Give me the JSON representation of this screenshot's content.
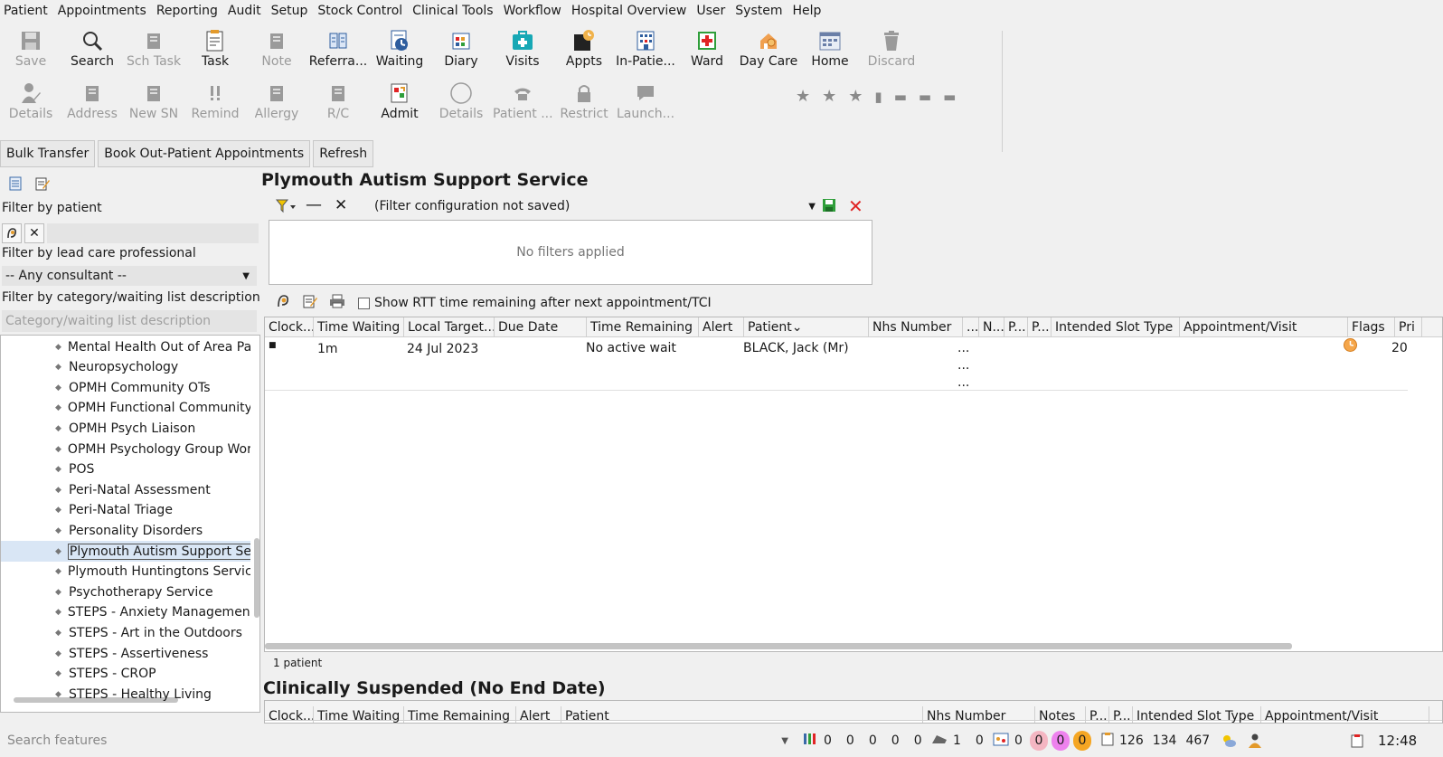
{
  "menu": [
    "Patient",
    "Appointments",
    "Reporting",
    "Audit",
    "Setup",
    "Stock Control",
    "Clinical Tools",
    "Workflow",
    "Hospital Overview",
    "User",
    "System",
    "Help"
  ],
  "toolbar_row1": [
    {
      "label": "Save",
      "icon": "save-icon",
      "enabled": false
    },
    {
      "label": "Search",
      "icon": "search-icon",
      "enabled": true
    },
    {
      "label": "Sch Task",
      "icon": "scheduled-task-icon",
      "enabled": false
    },
    {
      "label": "Task",
      "icon": "task-icon",
      "enabled": true
    },
    {
      "label": "Note",
      "icon": "note-icon",
      "enabled": false
    },
    {
      "label": "Referra...",
      "icon": "referral-icon",
      "enabled": true
    },
    {
      "label": "Waiting",
      "icon": "waiting-icon",
      "enabled": true
    },
    {
      "label": "Diary",
      "icon": "diary-icon",
      "enabled": true
    },
    {
      "label": "Visits",
      "icon": "visits-icon",
      "enabled": true
    },
    {
      "label": "Appts",
      "icon": "appointments-icon",
      "enabled": true
    },
    {
      "label": "In-Patie...",
      "icon": "in-patient-icon",
      "enabled": true
    },
    {
      "label": "Ward",
      "icon": "ward-icon",
      "enabled": true
    },
    {
      "label": "Day Care",
      "icon": "day-care-icon",
      "enabled": true
    },
    {
      "label": "Home",
      "icon": "home-icon",
      "enabled": true
    },
    {
      "label": "Discard",
      "icon": "discard-icon",
      "enabled": false
    }
  ],
  "toolbar_row2": [
    {
      "label": "Details",
      "icon": "patient-details-icon",
      "enabled": false
    },
    {
      "label": "Address",
      "icon": "address-icon",
      "enabled": false
    },
    {
      "label": "New SN",
      "icon": "new-sn-icon",
      "enabled": false
    },
    {
      "label": "Remind",
      "icon": "remind-icon",
      "enabled": false
    },
    {
      "label": "Allergy",
      "icon": "allergy-icon",
      "enabled": false
    },
    {
      "label": "R/C",
      "icon": "rc-icon",
      "enabled": false
    },
    {
      "label": "Admit",
      "icon": "admit-icon",
      "enabled": true
    },
    {
      "label": "Details",
      "icon": "circle-details-icon",
      "enabled": false
    },
    {
      "label": "Patient ...",
      "icon": "phone-icon",
      "enabled": false
    },
    {
      "label": "Restrict",
      "icon": "lock-icon",
      "enabled": false
    },
    {
      "label": "Launch...",
      "icon": "chat-icon",
      "enabled": false
    }
  ],
  "actions": {
    "bulk_transfer": "Bulk Transfer",
    "book_outpatient": "Book Out-Patient Appointments",
    "refresh": "Refresh"
  },
  "left": {
    "filter_patient_label": "Filter by patient",
    "filter_lead_label": "Filter by lead care professional",
    "consultant_value": "-- Any consultant --",
    "filter_category_label": "Filter by category/waiting list description",
    "category_placeholder": "Category/waiting list description",
    "tree_items": [
      "Mental Health Out of Area Patie",
      "Neuropsychology",
      "OPMH Community OTs",
      "OPMH Functional Community Te",
      "OPMH Psych Liaison",
      "OPMH Psychology Group Work",
      "POS",
      "Peri-Natal Assessment",
      "Peri-Natal Triage",
      "Personality Disorders",
      "Plymouth Autism Support Servic",
      "Plymouth Huntingtons Service",
      "Psychotherapy Service",
      "STEPS - Anxiety Management",
      "STEPS - Art in the Outdoors",
      "STEPS - Assertiveness",
      "STEPS - CROP",
      "STEPS - Healthy Living"
    ],
    "selected_index": 10
  },
  "main": {
    "title": "Plymouth Autism Support Service",
    "filter_config": "(Filter configuration not saved)",
    "no_filters": "No filters applied",
    "rtt_option": "Show RTT time remaining after next appointment/TCI",
    "columns": [
      "Clock...",
      "Time Waiting",
      "Local Target...",
      "Due Date",
      "Time Remaining ...",
      "Alert",
      "Patient",
      "Nhs Number",
      "...",
      "N...",
      "P...",
      "P...",
      "Intended Slot Type",
      "Appointment/Visit",
      "Flags",
      "Pri"
    ],
    "row": {
      "time_waiting": "1m",
      "local_target": "24 Jul 2023",
      "time_remaining": "No active wait",
      "patient": "BLACK, Jack (Mr)",
      "dots": "...",
      "priority": "20"
    },
    "count": "1 patient",
    "suspended_title": "Clinically Suspended (No End Date)",
    "suspended_columns": [
      "Clock...",
      "Time Waiting",
      "Time Remaining",
      "Alert",
      "Patient",
      "Nhs Number",
      "Notes",
      "P...",
      "P...",
      "Intended Slot Type",
      "Appointment/Visit"
    ]
  },
  "status": {
    "search_placeholder": "Search features",
    "counts_a": [
      "0",
      "0",
      "0",
      "0",
      "0"
    ],
    "count_b1": "1",
    "count_b2": "0",
    "count_c": "0",
    "badges": [
      {
        "v": "0",
        "color": "#f4b6c2"
      },
      {
        "v": "0",
        "color": "#ee82ee"
      },
      {
        "v": "0",
        "color": "#f5a623"
      }
    ],
    "nums": [
      "126",
      "134",
      "467"
    ],
    "time": "12:48"
  }
}
